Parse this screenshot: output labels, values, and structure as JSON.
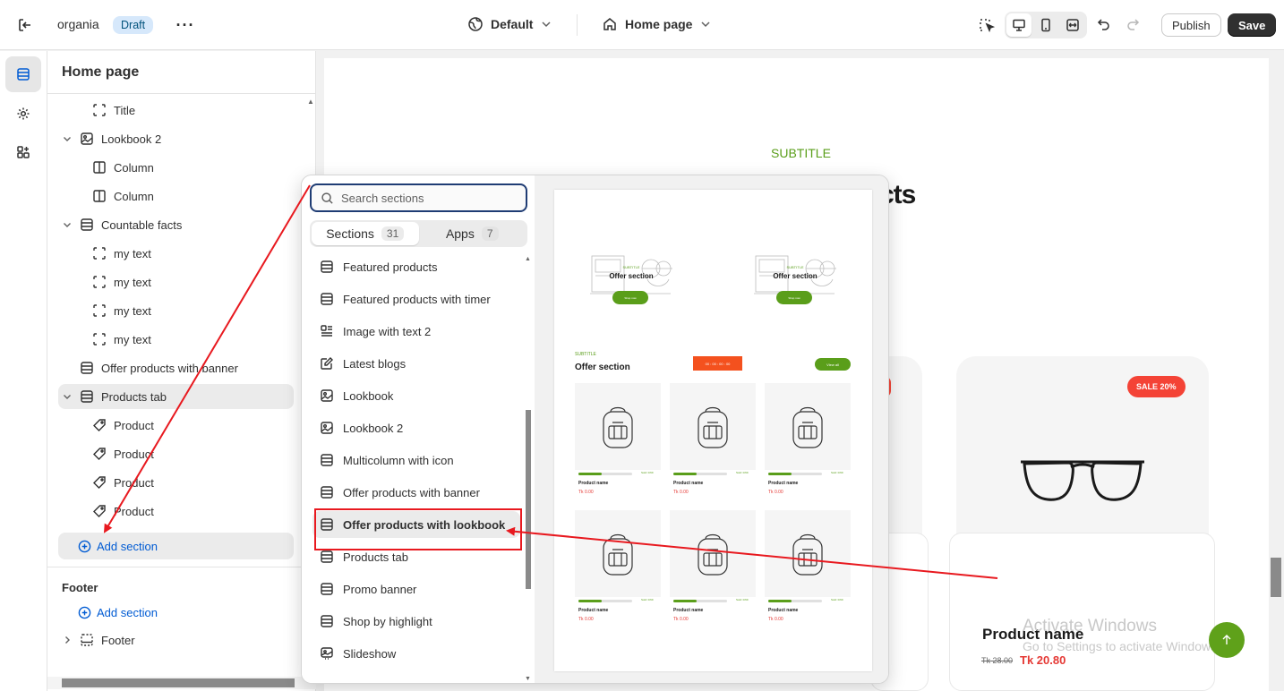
{
  "topbar": {
    "store_name": "organia",
    "status_badge": "Draft",
    "more_label": "···",
    "theme_label": "Default",
    "page_label": "Home page",
    "publish_label": "Publish",
    "save_label": "Save"
  },
  "sidebar": {
    "title": "Home page",
    "tree": [
      {
        "label": "Title",
        "icon": "block-icon",
        "level": 1,
        "expandable": false
      },
      {
        "label": "Lookbook 2",
        "icon": "image-section-icon",
        "level": 0,
        "expandable": true
      },
      {
        "label": "Column",
        "icon": "column-icon",
        "level": 1,
        "expandable": false
      },
      {
        "label": "Column",
        "icon": "column-icon",
        "level": 1,
        "expandable": false
      },
      {
        "label": "Countable facts",
        "icon": "section-icon",
        "level": 0,
        "expandable": true
      },
      {
        "label": "my text",
        "icon": "block-icon",
        "level": 1,
        "expandable": false
      },
      {
        "label": "my text",
        "icon": "block-icon",
        "level": 1,
        "expandable": false
      },
      {
        "label": "my text",
        "icon": "block-icon",
        "level": 1,
        "expandable": false
      },
      {
        "label": "my text",
        "icon": "block-icon",
        "level": 1,
        "expandable": false
      },
      {
        "label": "Offer products with banner",
        "icon": "section-icon",
        "level": 0,
        "expandable": false
      },
      {
        "label": "Products tab",
        "icon": "section-icon",
        "level": 0,
        "expandable": true,
        "selected": true
      },
      {
        "label": "Product",
        "icon": "tag-icon",
        "level": 1,
        "expandable": false
      },
      {
        "label": "Product",
        "icon": "tag-icon",
        "level": 1,
        "expandable": false
      },
      {
        "label": "Product",
        "icon": "tag-icon",
        "level": 1,
        "expandable": false
      },
      {
        "label": "Product",
        "icon": "tag-icon",
        "level": 1,
        "expandable": false
      }
    ],
    "add_section_label": "Add section",
    "footer_heading": "Footer",
    "footer_add_section_label": "Add section",
    "footer_node_label": "Footer"
  },
  "popup": {
    "search_placeholder": "Search sections",
    "tabs": [
      {
        "label": "Sections",
        "count": "31",
        "active": true
      },
      {
        "label": "Apps",
        "count": "7",
        "active": false
      }
    ],
    "items": [
      {
        "label": "Featured products",
        "icon": "section-icon"
      },
      {
        "label": "Featured products with timer",
        "icon": "section-icon"
      },
      {
        "label": "Image with text 2",
        "icon": "image-text-icon"
      },
      {
        "label": "Latest blogs",
        "icon": "blog-icon"
      },
      {
        "label": "Lookbook",
        "icon": "image-section-icon"
      },
      {
        "label": "Lookbook 2",
        "icon": "image-section-icon"
      },
      {
        "label": "Multicolumn with icon",
        "icon": "section-icon"
      },
      {
        "label": "Offer products with banner",
        "icon": "section-icon"
      },
      {
        "label": "Offer products with lookbook",
        "icon": "section-icon",
        "highlighted": true
      },
      {
        "label": "Products tab",
        "icon": "section-icon"
      },
      {
        "label": "Promo banner",
        "icon": "section-icon"
      },
      {
        "label": "Shop by highlight",
        "icon": "section-icon"
      },
      {
        "label": "Slideshow",
        "icon": "slideshow-icon"
      }
    ],
    "preview": {
      "banner_subtitle": "SUBTITLE",
      "banner_label": "Offer section",
      "banner_button": "Shop now",
      "section_subtitle": "SUBTITLE",
      "section_title": "Offer section",
      "countdown": "00 : 00 : 00 : 00",
      "view_all": "View all",
      "product_name": "Product name",
      "product_price": "Tk 0.00",
      "sold_label": "Sold: 0/99"
    }
  },
  "preview": {
    "subtitle": "SUBTITLE",
    "heading_fragment": "cts",
    "sale_badge": "SALE 20%",
    "product_name": "Product name",
    "old_price": "Tk 28.00",
    "new_price": "Tk 20.80",
    "watermark_title": "Activate Windows",
    "watermark_sub": "Go to Settings to activate Windows."
  },
  "colors": {
    "accent_blue": "#005bd3",
    "brand_green": "#5a9e1a",
    "sale_red": "#f44336",
    "annotation_red": "#e8191f"
  }
}
